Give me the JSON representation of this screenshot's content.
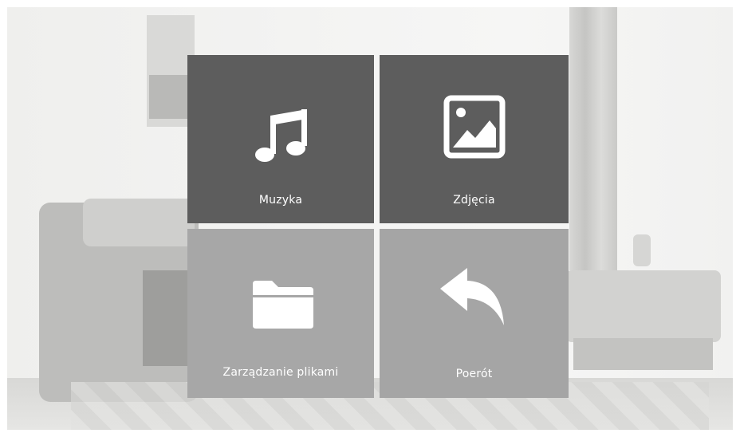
{
  "menu": {
    "tiles": [
      {
        "label": "Muzyka",
        "icon": "music-note-icon",
        "color": "#5d5d5d"
      },
      {
        "label": "Zdjęcia",
        "icon": "picture-icon",
        "color": "#5d5d5d"
      },
      {
        "label": "Zarządzanie plikami",
        "icon": "folder-icon",
        "color": "#a7a7a7"
      },
      {
        "label": "Poerót",
        "icon": "back-arrow-icon",
        "color": "#a5a5a5"
      }
    ]
  }
}
